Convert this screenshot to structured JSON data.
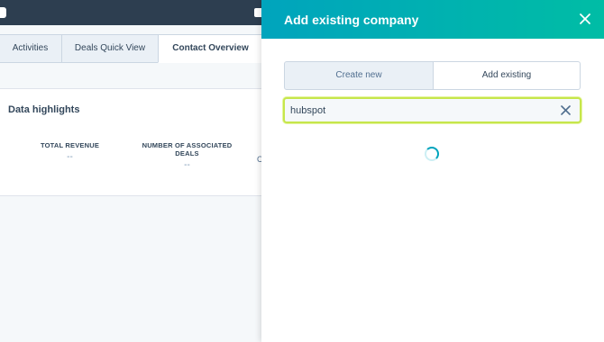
{
  "background_page": {
    "tabs": [
      {
        "label": "Activities"
      },
      {
        "label": "Deals Quick View"
      },
      {
        "label": "Contact Overview"
      }
    ],
    "data_highlights": {
      "title": "Data highlights",
      "stats": [
        {
          "label_line1": "TOTAL REVENUE",
          "label_line2": "",
          "value": "--"
        },
        {
          "label_line1": "NUMBER OF ASSOCIATED",
          "label_line2": "DEALS",
          "value": "--"
        }
      ],
      "truncated_letter": "C"
    }
  },
  "panel": {
    "title": "Add existing company",
    "close_icon": "close-icon",
    "segments": {
      "create_new": "Create new",
      "add_existing": "Add existing",
      "selected": "add_existing"
    },
    "search": {
      "value": "hubspot",
      "clear_icon": "clear-icon"
    },
    "loading": true
  },
  "colors": {
    "header_start": "#00a4bd",
    "header_end": "#00bda5",
    "focus_ring": "#c6e64b",
    "topbar": "#2d3e50",
    "spinner": "#00a4bd"
  }
}
